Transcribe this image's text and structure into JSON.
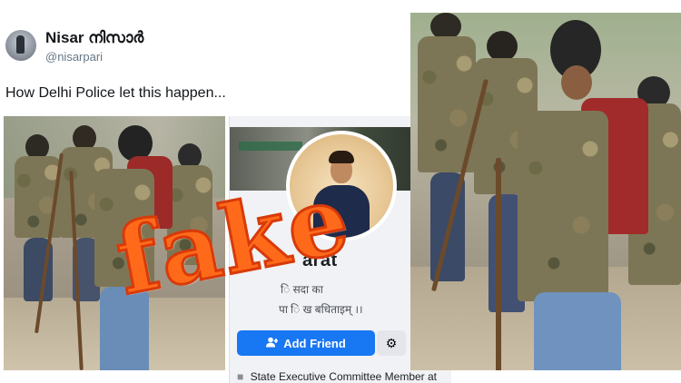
{
  "tweet": {
    "user_name": "Nisar നിസാർ",
    "handle": "@nisarpari",
    "text": "How Delhi Police let this happen..."
  },
  "facebook_profile": {
    "name_partial": "arat",
    "bio_line1": "ि सदा का",
    "bio_line2": "पा ि          ख बधिताइम् ।।",
    "add_friend_label": "Add Friend",
    "add_friend_icon": "add-person-icon",
    "settings_icon": "gear-icon",
    "more_icon": "more-dots-icon",
    "more_glyph": "•••",
    "intro_text": "State Executive Committee Member at"
  },
  "overlay": {
    "stamp_text": "fake"
  },
  "colors": {
    "stamp": "#ff6a1a",
    "facebook_blue": "#1877f2"
  }
}
